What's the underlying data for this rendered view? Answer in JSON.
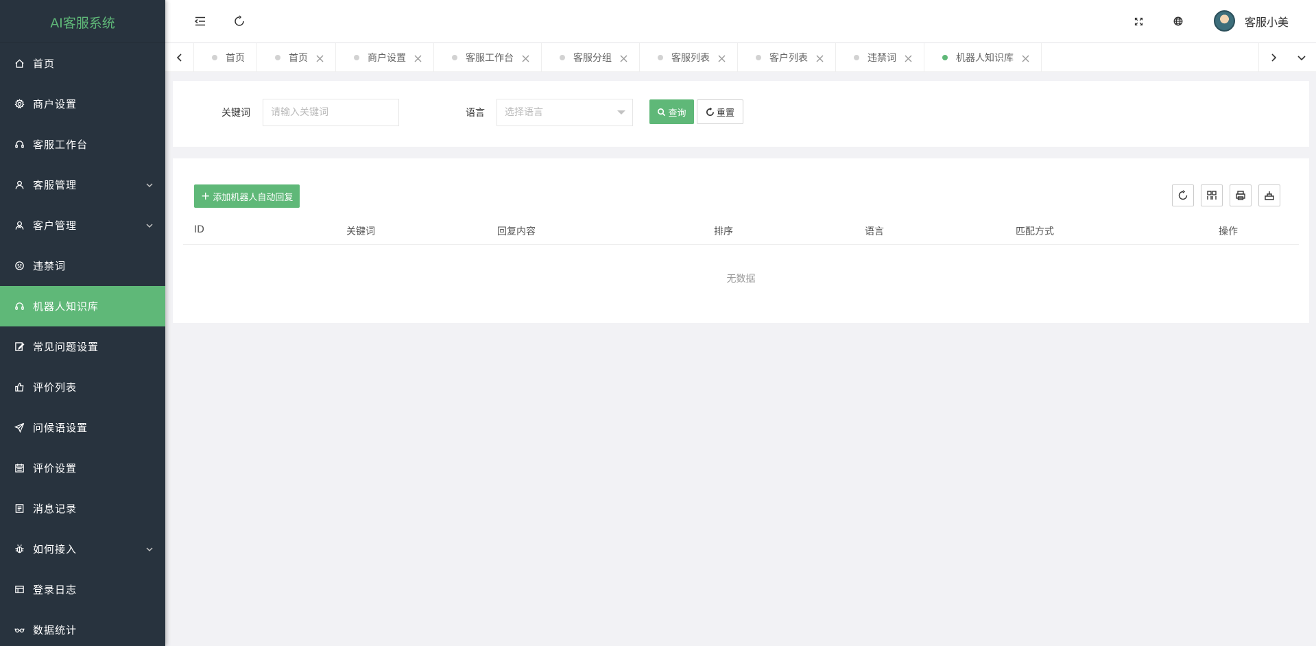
{
  "app": {
    "title": "AI客服系统"
  },
  "sidebar": {
    "items": [
      {
        "label": "首页",
        "icon": "home-icon"
      },
      {
        "label": "商户设置",
        "icon": "gear-icon"
      },
      {
        "label": "客服工作台",
        "icon": "headset-icon"
      },
      {
        "label": "客服管理",
        "icon": "user-icon",
        "expandable": true
      },
      {
        "label": "客户管理",
        "icon": "user-group-icon",
        "expandable": true
      },
      {
        "label": "违禁词",
        "icon": "face-icon"
      },
      {
        "label": "机器人知识库",
        "icon": "headset-icon",
        "active": true
      },
      {
        "label": "常见问题设置",
        "icon": "edit-icon"
      },
      {
        "label": "评价列表",
        "icon": "thumb-up-icon"
      },
      {
        "label": "问候语设置",
        "icon": "send-icon"
      },
      {
        "label": "评价设置",
        "icon": "calendar-icon"
      },
      {
        "label": "消息记录",
        "icon": "note-icon"
      },
      {
        "label": "如何接入",
        "icon": "bug-icon",
        "expandable": true
      },
      {
        "label": "登录日志",
        "icon": "table-icon"
      },
      {
        "label": "数据统计",
        "icon": "glasses-icon"
      }
    ]
  },
  "header": {
    "user_name": "客服小美"
  },
  "tabs": [
    {
      "label": "首页",
      "closable": false
    },
    {
      "label": "首页",
      "closable": true
    },
    {
      "label": "商户设置",
      "closable": true
    },
    {
      "label": "客服工作台",
      "closable": true
    },
    {
      "label": "客服分组",
      "closable": true
    },
    {
      "label": "客服列表",
      "closable": true
    },
    {
      "label": "客户列表",
      "closable": true
    },
    {
      "label": "违禁词",
      "closable": true
    },
    {
      "label": "机器人知识库",
      "closable": true,
      "active": true
    }
  ],
  "search": {
    "keyword_label": "关键词",
    "keyword_placeholder": "请输入关键词",
    "language_label": "语言",
    "language_placeholder": "选择语言",
    "query_button": "查询",
    "reset_button": "重置"
  },
  "table": {
    "add_button": "添加机器人自动回复",
    "columns": [
      "ID",
      "关键词",
      "回复内容",
      "排序",
      "语言",
      "匹配方式",
      "操作"
    ],
    "empty_text": "无数据"
  },
  "colors": {
    "accent": "#5fb878",
    "sidebar": "#28333e"
  }
}
